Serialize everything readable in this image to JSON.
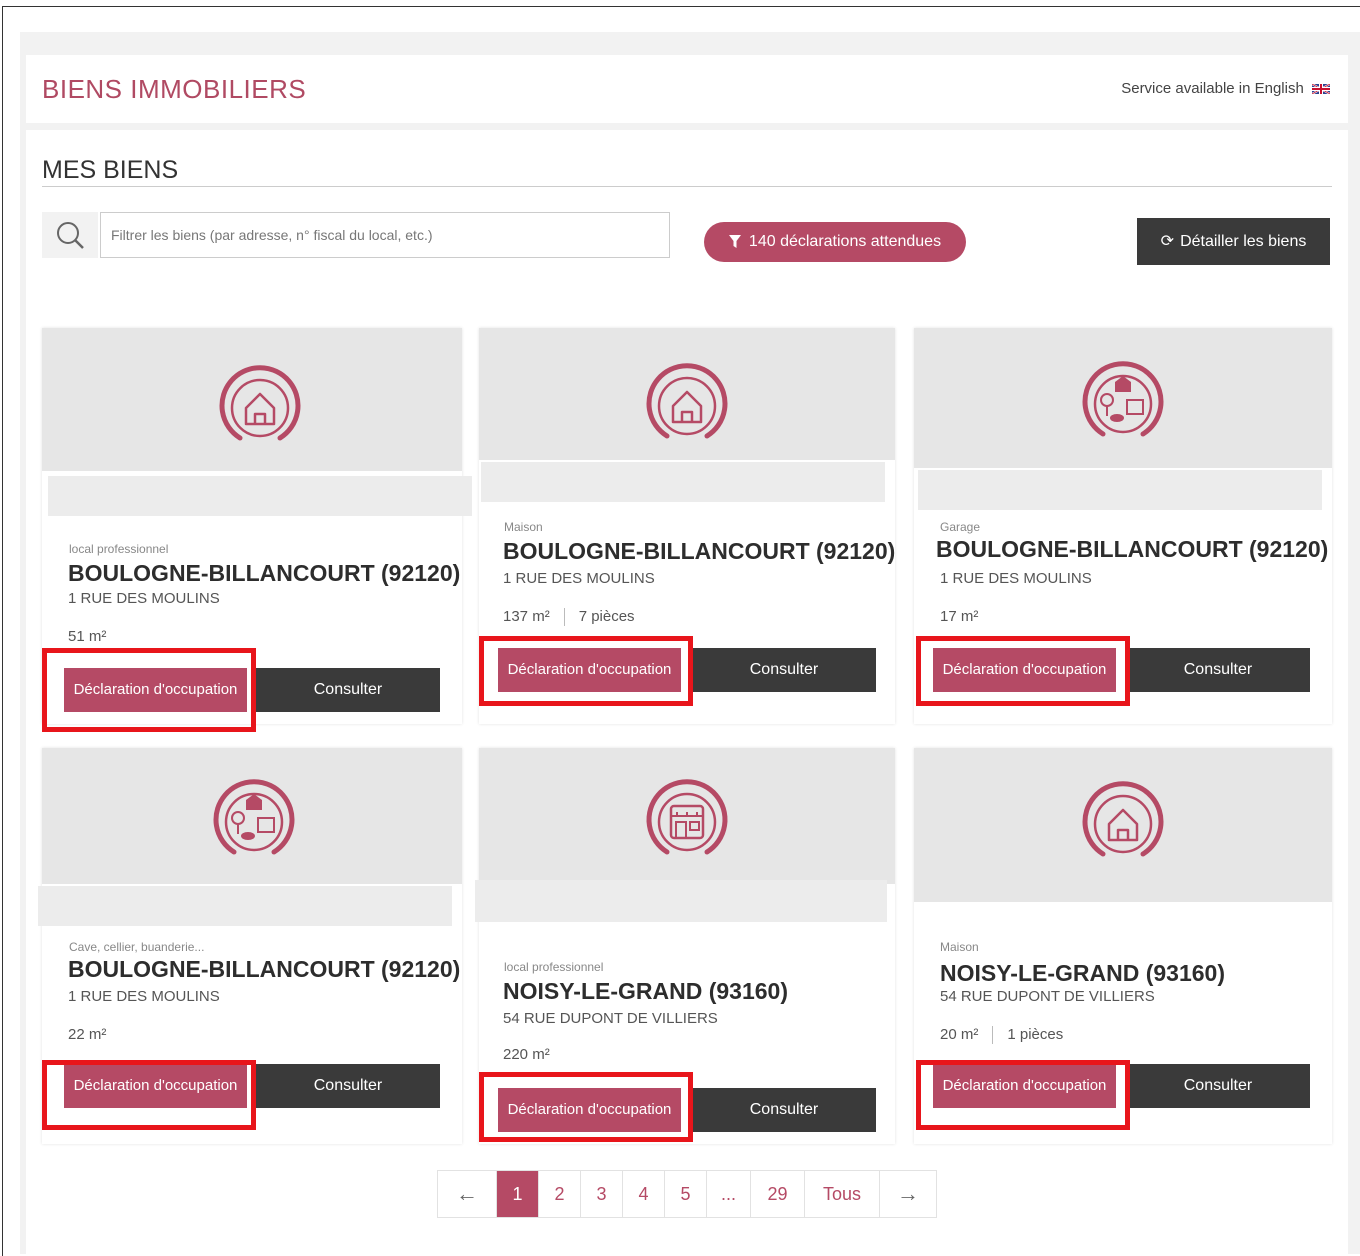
{
  "header": {
    "title": "BIENS IMMOBILIERS",
    "service_text": "Service available in English"
  },
  "section": {
    "title": "MES BIENS"
  },
  "search": {
    "placeholder": "Filtrer les biens (par adresse, n° fiscal du local, etc.)"
  },
  "declarations_badge": "140 déclarations attendues",
  "detail_button": "Détailler les biens",
  "colors": {
    "accent": "#b54a65",
    "dark_button": "#3a3a3a",
    "highlight": "#e8151b"
  },
  "cards": [
    {
      "icon": "house-icon",
      "type": "local professionnel",
      "city": "BOULOGNE-BILLANCOURT (92120)",
      "address": "1 RUE DES MOULINS",
      "size": "51 m²",
      "rooms": "",
      "decl_label": "Déclaration d'occupation",
      "consult_label": "Consulter"
    },
    {
      "icon": "house-icon",
      "type": "Maison",
      "city": "BOULOGNE-BILLANCOURT (92120)",
      "address": "1 RUE DES MOULINS",
      "size": "137 m²",
      "rooms": "7 pièces",
      "decl_label": "Déclaration d'occupation",
      "consult_label": "Consulter"
    },
    {
      "icon": "garage-icon",
      "type": "Garage",
      "city": "BOULOGNE-BILLANCOURT (92120)",
      "address": "1 RUE DES MOULINS",
      "size": "17 m²",
      "rooms": "",
      "decl_label": "Déclaration d'occupation",
      "consult_label": "Consulter"
    },
    {
      "icon": "cellar-icon",
      "type": "Cave, cellier, buanderie...",
      "city": "BOULOGNE-BILLANCOURT (92120)",
      "address": "1 RUE DES MOULINS",
      "size": "22 m²",
      "rooms": "",
      "decl_label": "Déclaration d'occupation",
      "consult_label": "Consulter"
    },
    {
      "icon": "shop-icon",
      "type": "local professionnel",
      "city": "NOISY-LE-GRAND (93160)",
      "address": "54 RUE DUPONT DE VILLIERS",
      "size": "220 m²",
      "rooms": "",
      "decl_label": "Déclaration d'occupation",
      "consult_label": "Consulter"
    },
    {
      "icon": "house-icon",
      "type": "Maison",
      "city": "NOISY-LE-GRAND (93160)",
      "address": "54 RUE DUPONT DE VILLIERS",
      "size": "20 m²",
      "rooms": "1 pièces",
      "decl_label": "Déclaration d'occupation",
      "consult_label": "Consulter"
    }
  ],
  "pagination": {
    "prev": "←",
    "pages": [
      "1",
      "2",
      "3",
      "4",
      "5",
      "...",
      "29",
      "Tous"
    ],
    "next": "→",
    "current": "1"
  }
}
